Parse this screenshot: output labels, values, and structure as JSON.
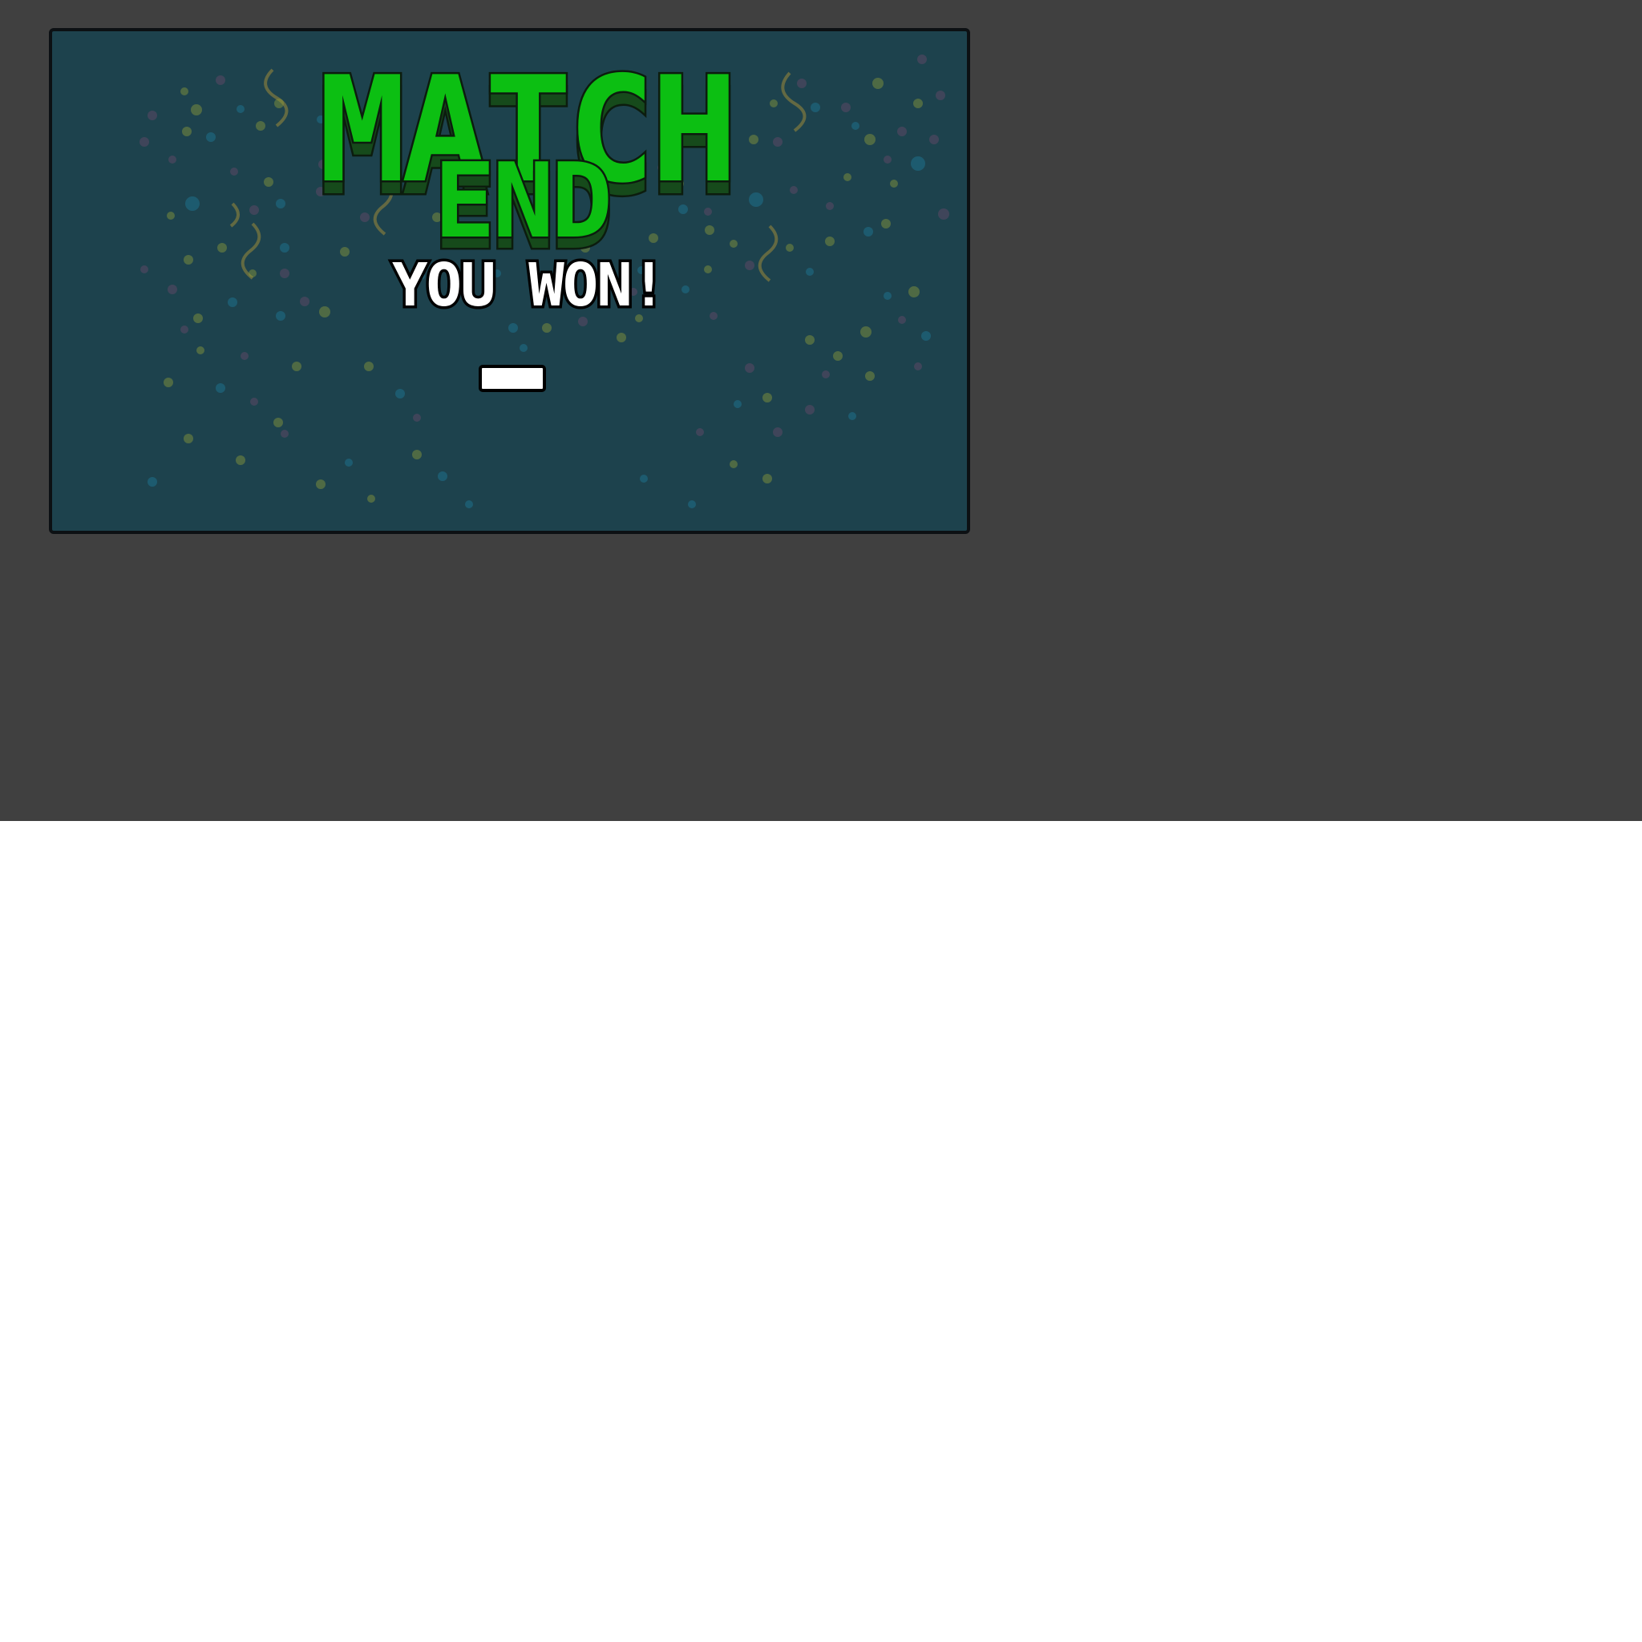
{
  "screen": {
    "title_line1": "MATCH",
    "title_line2": "END",
    "result_text": "YOU WON!",
    "continue_button_label": ""
  },
  "colors": {
    "backdrop": "#404040",
    "panel": "#1d424d",
    "panel_border": "#0c1013",
    "title_green": "#0cbf12",
    "title_shadow": "#164a1b",
    "result_text": "#ffffff",
    "button_fill": "#ffffff"
  },
  "icons": {
    "background_decoration": "confetti"
  }
}
